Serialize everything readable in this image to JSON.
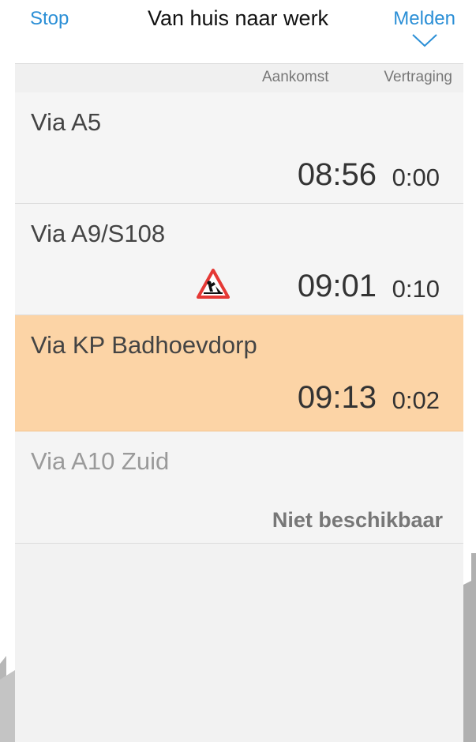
{
  "header": {
    "stop_label": "Stop",
    "title": "Van huis naar werk",
    "melden_label": "Melden"
  },
  "columns": {
    "arrival_label": "Aankomst",
    "delay_label": "Vertraging"
  },
  "routes": [
    {
      "name": "Via A5",
      "arrival": "08:56",
      "delay": "0:00"
    },
    {
      "name": "Via A9/S108",
      "arrival": "09:01",
      "delay": "0:10",
      "icon": "roadworks-warning-icon"
    },
    {
      "name": "Via KP Badhoevdorp",
      "arrival": "09:13",
      "delay": "0:02",
      "highlighted": true
    },
    {
      "name": "Via A10 Zuid",
      "status": "Niet beschikbaar"
    }
  ],
  "colors": {
    "accent": "#2b8fd6",
    "highlight": "#fcd4a6",
    "warning": "#e53935"
  }
}
